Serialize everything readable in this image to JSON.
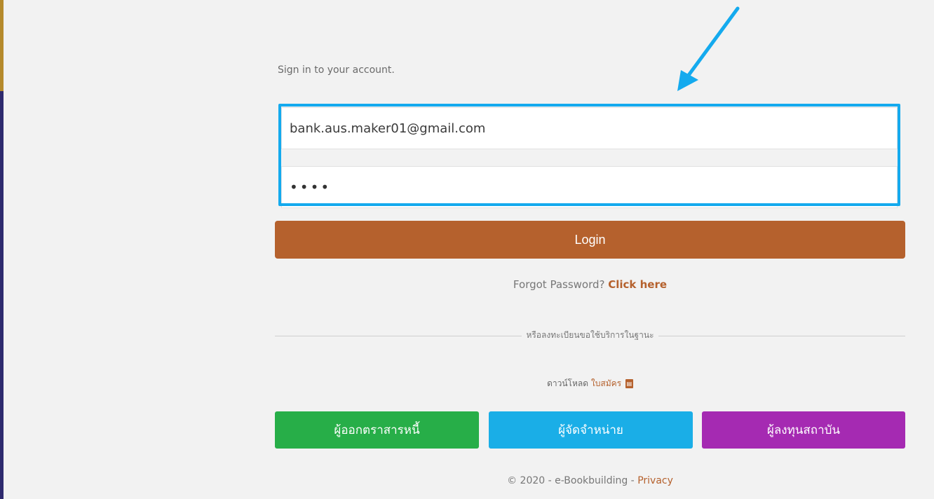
{
  "login": {
    "subtitle": "Sign in to your account.",
    "email_value": "bank.aus.maker01@gmail.com",
    "password_value": "••••",
    "login_label": "Login",
    "forgot_prefix": "Forgot Password?",
    "forgot_link": "Click here",
    "divider_text": "หรือลงทะเบียนขอใช้บริการในฐานะ",
    "download_prefix": "ดาวน์โหลด",
    "download_link": "ใบสมัคร"
  },
  "roles": [
    {
      "label": "ผู้ออกตราสารหนี้",
      "color": "#27ae48"
    },
    {
      "label": "ผู้จัดจำหน่าย",
      "color": "#1aaee7"
    },
    {
      "label": "ผู้ลงทุนสถาบัน",
      "color": "#a52ab2"
    }
  ],
  "footer": {
    "text": "© 2020 - e-Bookbuilding -",
    "privacy_link": "Privacy"
  },
  "colors": {
    "accent": "#b5612d",
    "highlight": "#14aaee"
  },
  "icons": {
    "pdf": "pdf-icon"
  }
}
